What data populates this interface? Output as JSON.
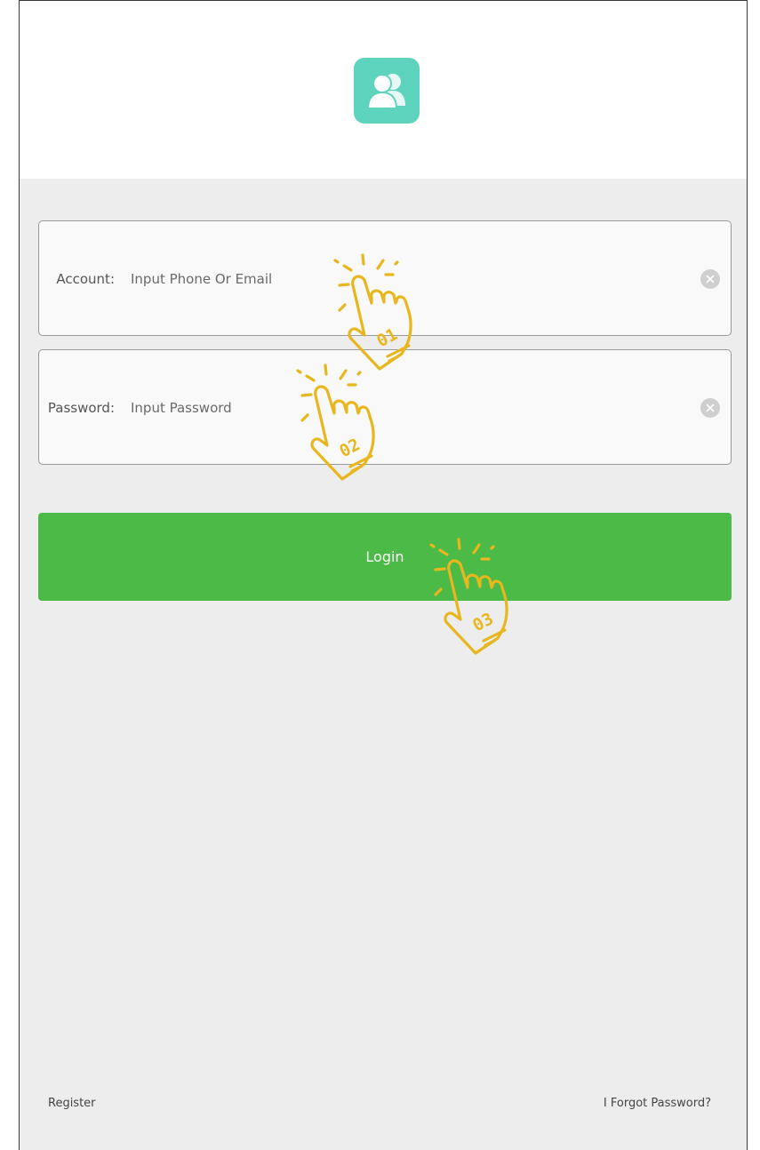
{
  "header": {
    "logo_icon": "users-icon",
    "logo_color": "#5ed3be"
  },
  "form": {
    "account": {
      "label": "Account:",
      "placeholder": "Input Phone Or Email",
      "value": "",
      "clear_icon": "clear-circle-icon"
    },
    "password": {
      "label": "Password:",
      "placeholder": "Input Password",
      "value": "",
      "clear_icon": "clear-circle-icon"
    },
    "login_label": "Login",
    "login_color": "#4cba46"
  },
  "footer": {
    "register_label": "Register",
    "forgot_label": "I Forgot Password?"
  },
  "annotations": {
    "icon": "tap-hand-icon",
    "color": "#e8b61e",
    "steps": [
      "01",
      "02",
      "03"
    ]
  }
}
